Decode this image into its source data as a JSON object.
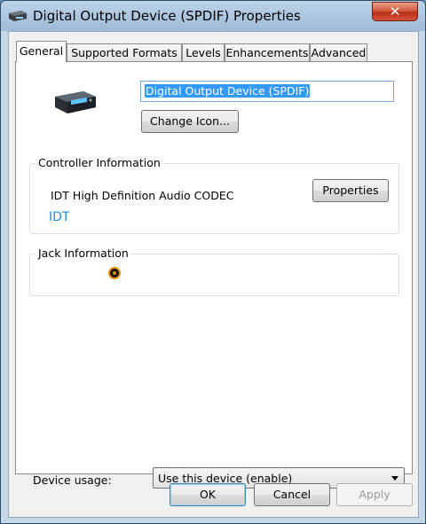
{
  "window": {
    "title": "Digital Output Device (SPDIF) Properties",
    "close_label": "✕"
  },
  "tabs": [
    {
      "label": "General",
      "active": true
    },
    {
      "label": "Supported Formats",
      "active": false
    },
    {
      "label": "Levels",
      "active": false
    },
    {
      "label": "Enhancements",
      "active": false
    },
    {
      "label": "Advanced",
      "active": false
    }
  ],
  "general": {
    "device_name": "Digital Output Device (SPDIF)",
    "change_icon_label": "Change Icon...",
    "controller": {
      "group_label": "Controller Information",
      "name": "IDT High Definition Audio CODEC",
      "vendor_link": "IDT",
      "properties_label": "Properties"
    },
    "jack": {
      "group_label": "Jack Information",
      "jack_color": "#e88c10"
    },
    "device_usage": {
      "label": "Device usage:",
      "selected": "Use this device (enable)"
    }
  },
  "buttons": {
    "ok": "OK",
    "cancel": "Cancel",
    "apply": "Apply"
  }
}
